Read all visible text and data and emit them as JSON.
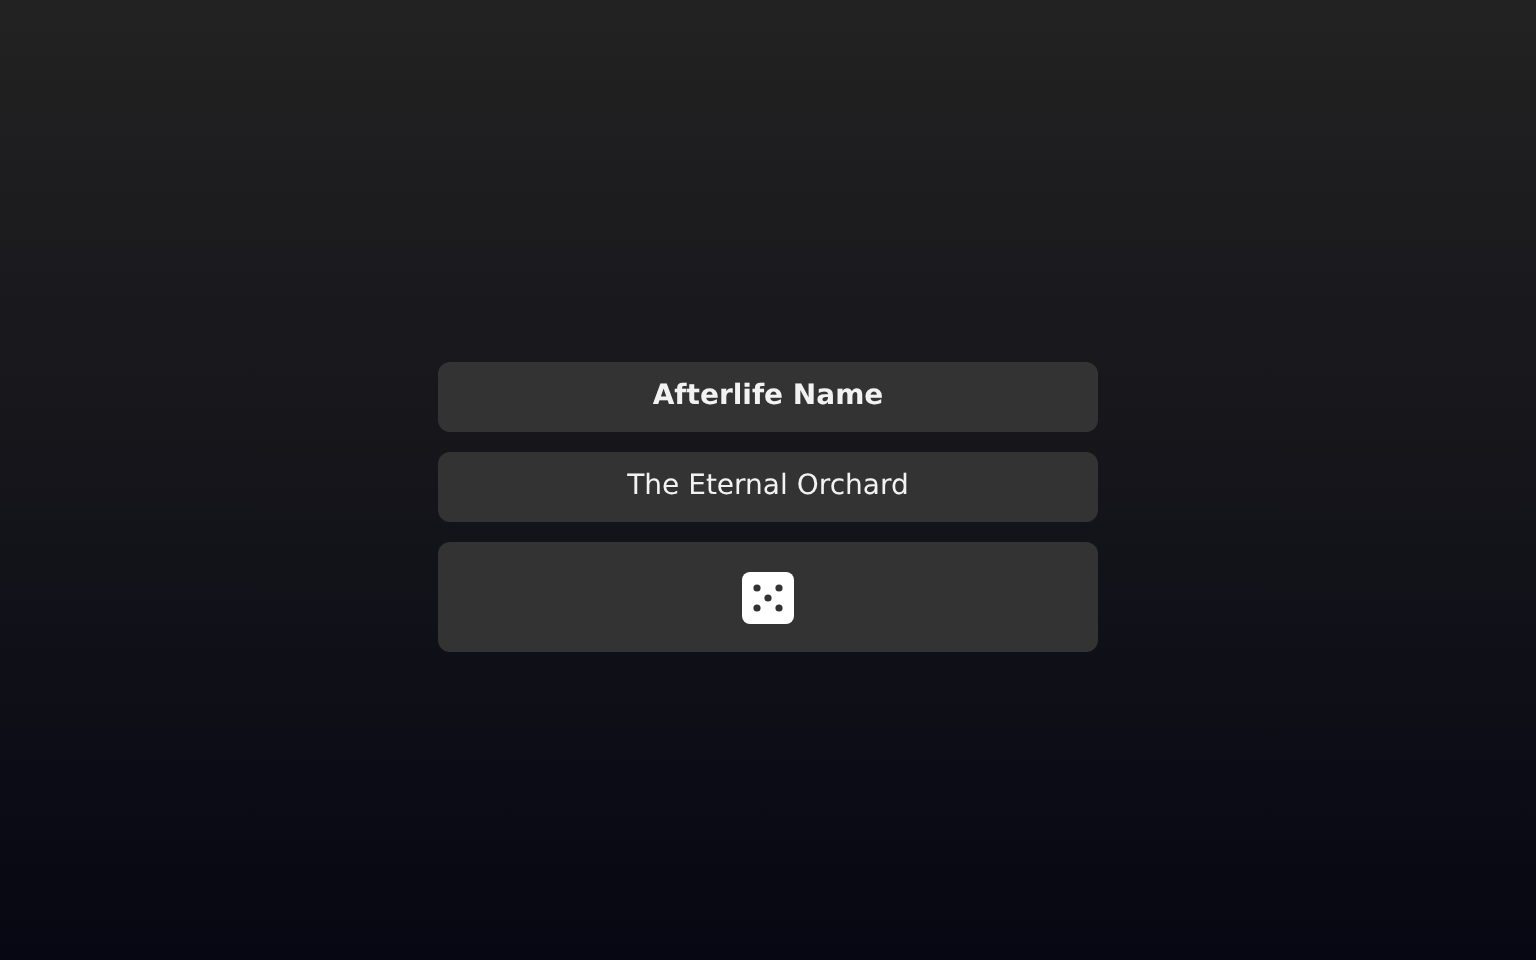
{
  "title": "Afterlife Name",
  "name": "The Eternal Orchard"
}
